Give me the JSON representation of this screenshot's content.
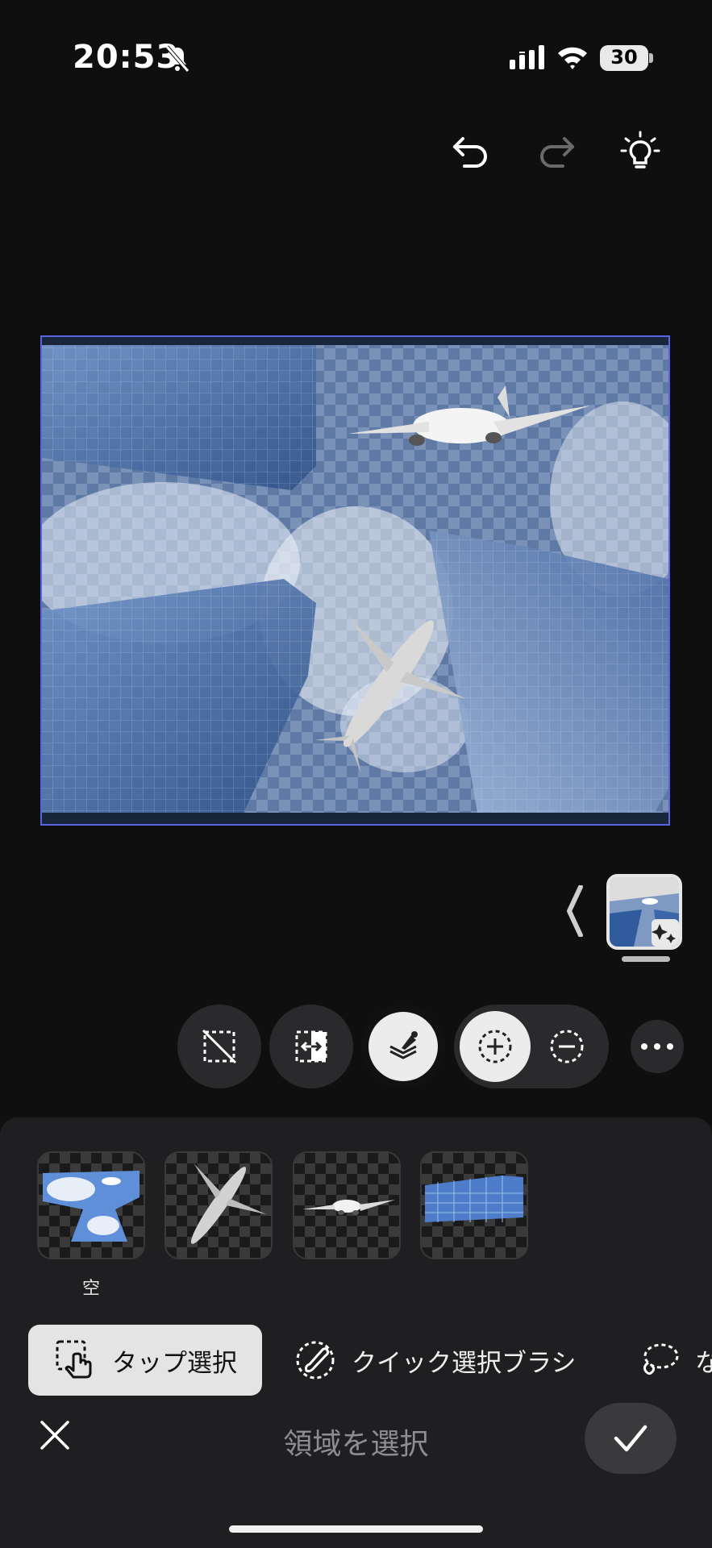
{
  "status_bar": {
    "time": "20:53",
    "battery": "30"
  },
  "toolbar": {
    "icons": [
      "undo-icon",
      "redo-icon",
      "lightbulb-icon"
    ]
  },
  "tools": {
    "icons": [
      "deselect-icon",
      "invert-selection-icon",
      "eyedropper-icon",
      "add-selection-icon",
      "subtract-selection-icon",
      "more-icon"
    ],
    "active": "eyedropper-icon"
  },
  "detected_objects": [
    {
      "label": "空"
    },
    {
      "label": ""
    },
    {
      "label": ""
    },
    {
      "label": ""
    }
  ],
  "modes": [
    {
      "label": "タップ選択",
      "icon": "tap-select-icon",
      "active": true
    },
    {
      "label": "クイック選択ブラシ",
      "icon": "quick-brush-icon",
      "active": false
    },
    {
      "label": "な",
      "icon": "lasso-icon",
      "active": false
    }
  ],
  "footer": {
    "title": "領域を選択"
  },
  "colors": {
    "selection_border": "#5a63e6",
    "background": "#0f0f10",
    "sheet": "#1f1f21"
  }
}
